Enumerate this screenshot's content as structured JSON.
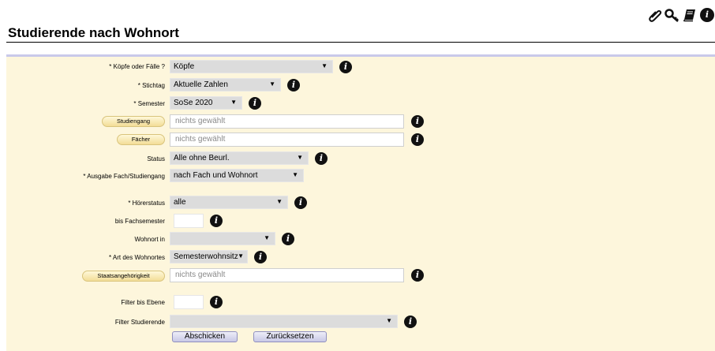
{
  "toolbar": {
    "icons": [
      "paperclip-icon",
      "key-icon",
      "book-icon",
      "info-icon"
    ]
  },
  "page": {
    "title": "Studierende nach Wohnort"
  },
  "form": {
    "koepfe_label": "* Köpfe oder Fälle ?",
    "koepfe_value": "Köpfe",
    "stichtag_label": "* Stichtag",
    "stichtag_value": "Aktuelle Zahlen",
    "semester_label": "* Semester",
    "semester_value": "SoSe 2020",
    "studiengang_button": "Studiengang",
    "studiengang_placeholder": "nichts gewählt",
    "faecher_button": "Fächer",
    "faecher_placeholder": "nichts gewählt",
    "status_label": "Status",
    "status_value": "Alle ohne Beurl.",
    "ausgabe_label": "* Ausgabe Fach/Studiengang",
    "ausgabe_value": "nach Fach und Wohnort",
    "hoererstatus_label": "* Hörerstatus",
    "hoererstatus_value": "alle",
    "bis_fachsemester_label": "bis Fachsemester",
    "bis_fachsemester_value": "",
    "wohnort_label": "Wohnort in",
    "wohnort_value": "",
    "art_wohnort_label": "* Art des Wohnortes",
    "art_wohnort_value": "Semesterwohnsitz",
    "staatsangehoerigkeit_button": "Staatsangehörigkeit",
    "staatsangehoerigkeit_placeholder": "nichts gewählt",
    "filter_ebene_label": "Filter bis Ebene",
    "filter_ebene_value": "",
    "filter_studierende_label": "Filter Studierende",
    "filter_studierende_value": "",
    "submit_label": "Abschicken",
    "reset_label": "Zurücksetzen",
    "dropdown_arrow": "▼",
    "info_glyph": "i"
  }
}
